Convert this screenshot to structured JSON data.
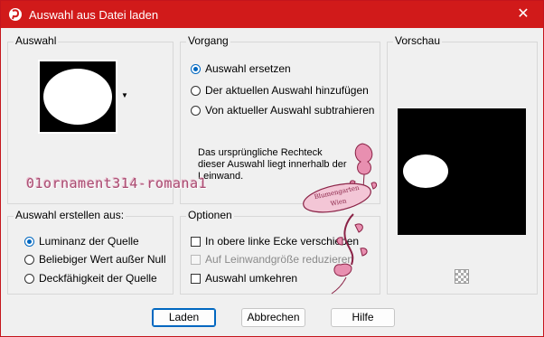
{
  "window": {
    "title": "Auswahl aus Datei laden",
    "close_label": "✕"
  },
  "auswahl": {
    "title": "Auswahl"
  },
  "vorgang": {
    "title": "Vorgang",
    "options": [
      {
        "label": "Auswahl ersetzen",
        "checked": true
      },
      {
        "label": "Der aktuellen Auswahl hinzufügen",
        "checked": false
      },
      {
        "label": "Von aktueller Auswahl subtrahieren",
        "checked": false
      }
    ],
    "info": "Das ursprüngliche Rechteck dieser Auswahl liegt innerhalb der Leinwand."
  },
  "vorschau": {
    "title": "Vorschau"
  },
  "erstellen": {
    "title": "Auswahl erstellen aus:",
    "options": [
      {
        "label": "Luminanz der Quelle",
        "checked": true
      },
      {
        "label": "Beliebiger Wert außer Null",
        "checked": false
      },
      {
        "label": "Deckfähigkeit der Quelle",
        "checked": false
      }
    ]
  },
  "optionen": {
    "title": "Optionen",
    "checks": [
      {
        "label": "In obere linke Ecke verschieben",
        "checked": false,
        "disabled": false
      },
      {
        "label": "Auf Leinwandgröße reduzieren",
        "checked": false,
        "disabled": true
      },
      {
        "label": "Auswahl umkehren",
        "checked": false,
        "disabled": false
      }
    ]
  },
  "buttons": {
    "load": "Laden",
    "cancel": "Abbrechen",
    "help": "Hilfe"
  },
  "overlay": {
    "watermark": "01ornament314-romana1",
    "stamp_line1": "Blumengarten",
    "stamp_line2": "Wien"
  },
  "colors": {
    "titlebar": "#d11a1a",
    "accent": "#0067c0",
    "watermark": "#a94d72"
  }
}
